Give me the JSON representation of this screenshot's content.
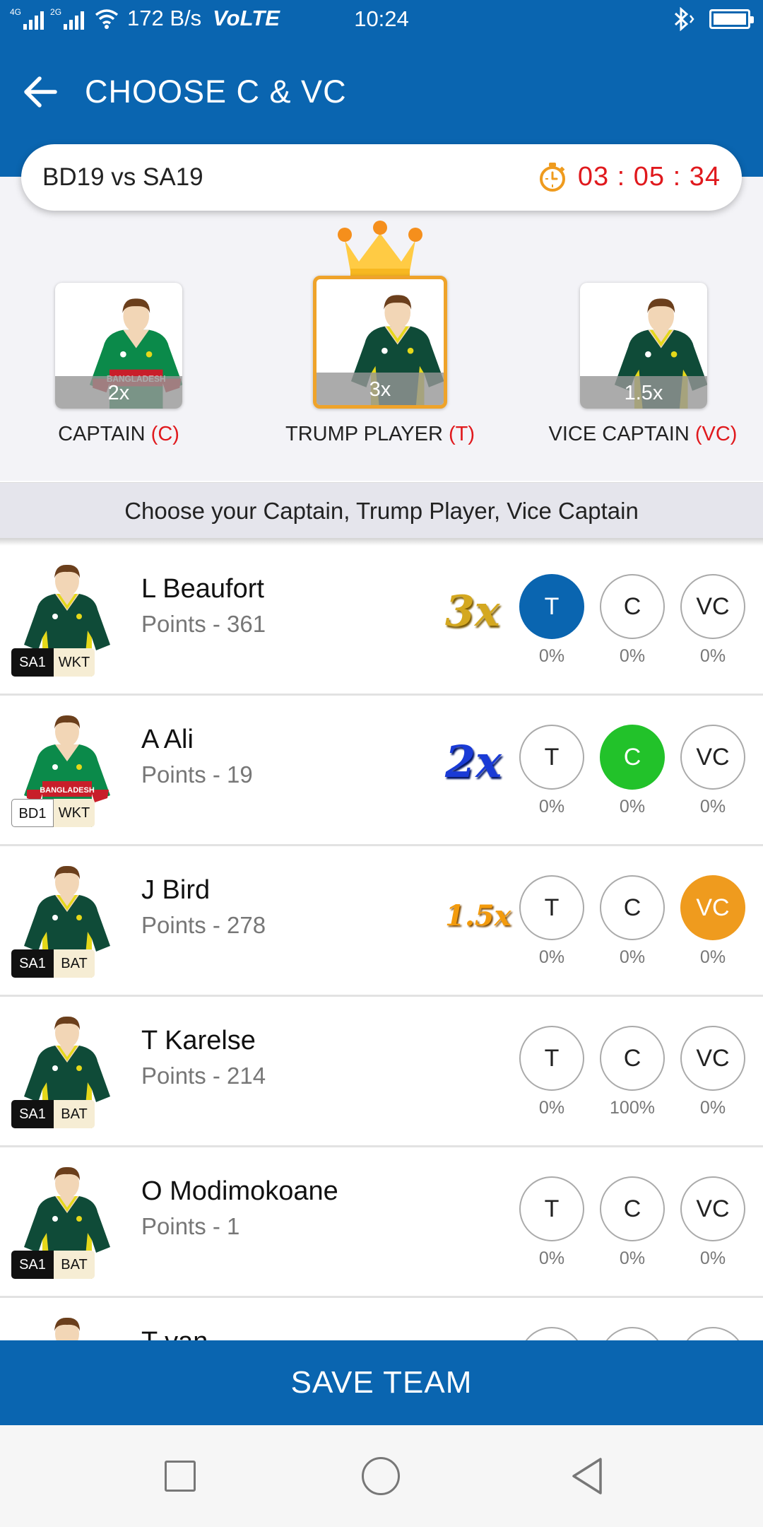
{
  "status_bar": {
    "net_1": "4G",
    "net_2": "2G",
    "speed": "172 B/s",
    "volte": "VoLTE",
    "time": "10:24",
    "icons": [
      "signal-icon",
      "wifi-icon",
      "bluetooth-icon",
      "battery-icon"
    ]
  },
  "header": {
    "title": "CHOOSE C & VC",
    "back_icon": "arrow-left-icon"
  },
  "match": {
    "title": "BD19 vs SA19",
    "timer": "03 : 05 : 34",
    "timer_icon": "stopwatch-icon"
  },
  "selection": {
    "captain": {
      "multiplier": "2x",
      "label": "CAPTAIN",
      "abbr": "(C)",
      "jersey": "bangladesh"
    },
    "trump": {
      "multiplier": "3x",
      "label": "TRUMP PLAYER",
      "abbr": "(T)",
      "jersey": "south-africa"
    },
    "vice": {
      "multiplier": "1.5x",
      "label": "VICE CAPTAIN",
      "abbr": "(VC)",
      "jersey": "south-africa"
    }
  },
  "banner": "Choose your Captain, Trump Player, Vice Captain",
  "option_labels": {
    "t": "T",
    "c": "C",
    "vc": "VC"
  },
  "players": [
    {
      "name": "L Beaufort",
      "points": "Points - 361",
      "team": "SA1",
      "role": "WKT",
      "badge": "3x",
      "selected": "T",
      "pct": {
        "t": "0%",
        "c": "0%",
        "vc": "0%"
      }
    },
    {
      "name": "A Ali",
      "points": "Points - 19",
      "team": "BD1",
      "role": "WKT",
      "badge": "2x",
      "selected": "C",
      "pct": {
        "t": "0%",
        "c": "0%",
        "vc": "0%"
      }
    },
    {
      "name": "J Bird",
      "points": "Points - 278",
      "team": "SA1",
      "role": "BAT",
      "badge": "1.5x",
      "selected": "VC",
      "pct": {
        "t": "0%",
        "c": "0%",
        "vc": "0%"
      }
    },
    {
      "name": "T Karelse",
      "points": "Points - 214",
      "team": "SA1",
      "role": "BAT",
      "badge": "",
      "selected": "",
      "pct": {
        "t": "0%",
        "c": "100%",
        "vc": "0%"
      }
    },
    {
      "name": "O Modimokoane",
      "points": "Points - 1",
      "team": "SA1",
      "role": "BAT",
      "badge": "",
      "selected": "",
      "pct": {
        "t": "0%",
        "c": "0%",
        "vc": "0%"
      }
    },
    {
      "name": "T van",
      "points": "",
      "team": "",
      "role": "",
      "badge": "",
      "selected": "",
      "pct": {
        "t": "",
        "c": "",
        "vc": ""
      }
    }
  ],
  "save_button": "SAVE TEAM",
  "colors": {
    "primary": "#0a65b0",
    "captain_green": "#22c22a",
    "vice_orange": "#ef9b1e",
    "trump_border": "#efa32a",
    "timer_red": "#e0191d"
  }
}
